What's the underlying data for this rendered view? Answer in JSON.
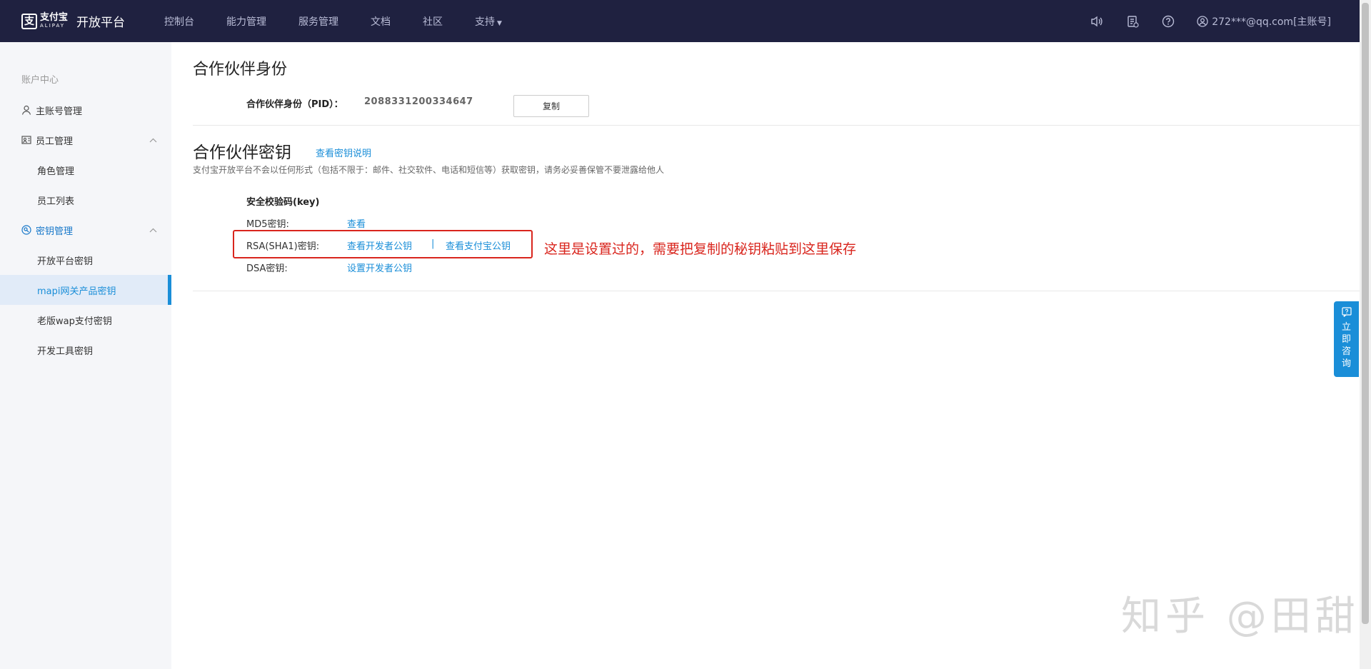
{
  "header": {
    "logo_cn": "支付宝",
    "logo_en": "ALIPAY",
    "platform": "开放平台",
    "nav": [
      "控制台",
      "能力管理",
      "服务管理",
      "文档",
      "社区",
      "支持"
    ],
    "user": "272***@qq.com[主账号]"
  },
  "sidebar": {
    "section": "账户中心",
    "items": [
      {
        "label": "主账号管理"
      },
      {
        "label": "员工管理"
      },
      {
        "label": "角色管理"
      },
      {
        "label": "员工列表"
      },
      {
        "label": "密钥管理"
      },
      {
        "label": "开放平台密钥"
      },
      {
        "label": "mapi网关产品密钥"
      },
      {
        "label": "老版wap支付密钥"
      },
      {
        "label": "开发工具密钥"
      }
    ]
  },
  "main": {
    "partner_title": "合作伙伴身份",
    "pid_label": "合作伙伴身份（PID）：",
    "pid_value": "2088331200334647",
    "copy_label": "复制",
    "key_title": "合作伙伴密钥",
    "key_doc_link": "查看密钥说明",
    "notice": "支付宝开放平台不会以任何形式（包括不限于：邮件、社交软件、电话和短信等）获取密钥，请务必妥善保管不要泄露给他人",
    "security_label": "安全校验码(key)",
    "md5_label": "MD5密钥:",
    "md5_link": "查看",
    "rsa_label": "RSA(SHA1)密钥:",
    "rsa_link1": "查看开发者公钥",
    "rsa_sep": "|",
    "rsa_link2": "查看支付宝公钥",
    "dsa_label": "DSA密钥:",
    "dsa_link": "设置开发者公钥",
    "annotation": "这里是设置过的，需要把复制的秘钥粘贴到这里保存"
  },
  "consult": "立即咨询",
  "watermark": "知乎 @田甜",
  "colors": {
    "nav_bg": "#1f2140",
    "accent": "#1a8ed8",
    "annotation_red": "#d9251d"
  }
}
